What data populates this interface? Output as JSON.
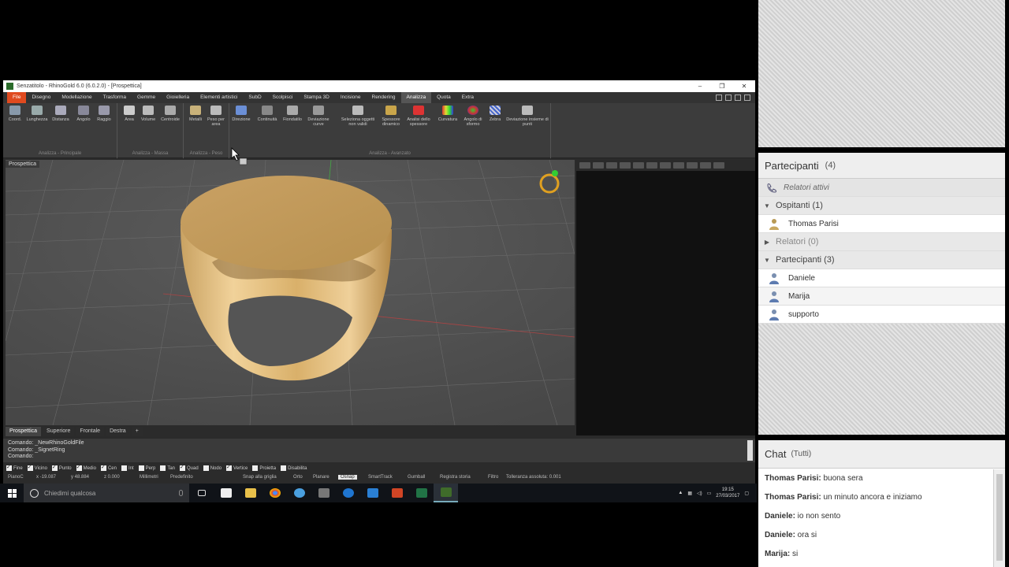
{
  "window": {
    "title": "Senzatitolo - RhinoGold 6.0 (6.0.2.0) - [Prospettica]",
    "controls": [
      "–",
      "❐",
      "✕"
    ]
  },
  "menu": {
    "items": [
      "File",
      "Disegno",
      "Modellazione",
      "Trasforma",
      "Gemme",
      "Gioielleria",
      "Elementi artistici",
      "SubD",
      "Scolpisci",
      "Stampa 3D",
      "Incisione",
      "Rendering",
      "Analizza",
      "Quota",
      "Extra"
    ],
    "active": "Analizza"
  },
  "ribbon": {
    "groups": [
      {
        "label": "Analizza - Principale",
        "tools": [
          "Coord.",
          "Lunghezza",
          "Distanza",
          "Angolo",
          "Raggio"
        ]
      },
      {
        "label": "Analizza - Massa",
        "tools": [
          "Area",
          "Volume",
          "Centroide"
        ]
      },
      {
        "label": "Analizza - Peso",
        "tools": [
          "Metalli",
          "Peso per area"
        ]
      },
      {
        "label": "Analizza - Avanzato",
        "tools": [
          "Direzione",
          "Continuità",
          "Fiondatilo",
          "Deviazione curve",
          "Seleziona oggetti non validi",
          "Spessore dinamico",
          "Analisi dello spessore",
          "Curvatura",
          "Angolo di sformo",
          "Zebra",
          "Deviazione insieme di punti"
        ]
      }
    ],
    "colors": {
      "file_tab": "#e04a1f",
      "ribbon_bg": "#3c3c3c"
    }
  },
  "viewport": {
    "label": "Prospettica",
    "tabs": [
      "Prospettica",
      "Superiore",
      "Frontale",
      "Destra",
      "+"
    ],
    "active_tab": "Prospettica"
  },
  "command": {
    "lines": [
      "Comando: _NewRhinoGoldFile",
      "Comando: _SignetRing",
      "Comando:"
    ]
  },
  "osnap": [
    {
      "label": "Fine",
      "on": true
    },
    {
      "label": "Vicino",
      "on": true
    },
    {
      "label": "Punto",
      "on": true
    },
    {
      "label": "Medio",
      "on": true
    },
    {
      "label": "Cen",
      "on": true
    },
    {
      "label": "Int",
      "on": false
    },
    {
      "label": "Perp",
      "on": false
    },
    {
      "label": "Tan",
      "on": false
    },
    {
      "label": "Quad",
      "on": true
    },
    {
      "label": "Nodo",
      "on": false
    },
    {
      "label": "Vertice",
      "on": true
    },
    {
      "label": "Proietta",
      "on": false
    },
    {
      "label": "Disabilita",
      "on": false
    }
  ],
  "status": {
    "plane": "PianoC",
    "x": "x -19.087",
    "y": "y 48.884",
    "z": "z 0.000",
    "units": "Millimetri",
    "layer": "Predefinito",
    "items": [
      "Snap alla griglia",
      "Orto",
      "Planare",
      "Osnap",
      "SmartTrack",
      "Gumball",
      "Registra storia",
      "Filtro",
      "Tolleranza assoluta: 0.001"
    ],
    "highlighted": "Osnap"
  },
  "taskbar": {
    "search_placeholder": "Chiedimi qualcosa",
    "time": "19:15",
    "date": "27/03/2017"
  },
  "participants": {
    "title": "Partecipanti",
    "count": "(4)",
    "active_speakers": "Relatori attivi",
    "sections": [
      {
        "label": "Ospitanti (1)",
        "expanded": true,
        "people": [
          "Thomas Parisi"
        ]
      },
      {
        "label": "Relatori (0)",
        "expanded": false,
        "people": []
      },
      {
        "label": "Partecipanti (3)",
        "expanded": true,
        "people": [
          "Daniele",
          "Marija",
          "supporto"
        ]
      }
    ]
  },
  "chat": {
    "title": "Chat",
    "scope": "(Tutti)",
    "messages": [
      {
        "from": "Thomas Parisi:",
        "text": " buona sera"
      },
      {
        "from": "Thomas Parisi:",
        "text": " un minuto ancora e iniziamo"
      },
      {
        "from": "Daniele:",
        "text": " io non sento"
      },
      {
        "from": "Daniele:",
        "text": " ora si"
      },
      {
        "from": "Marija:",
        "text": " si"
      }
    ]
  }
}
